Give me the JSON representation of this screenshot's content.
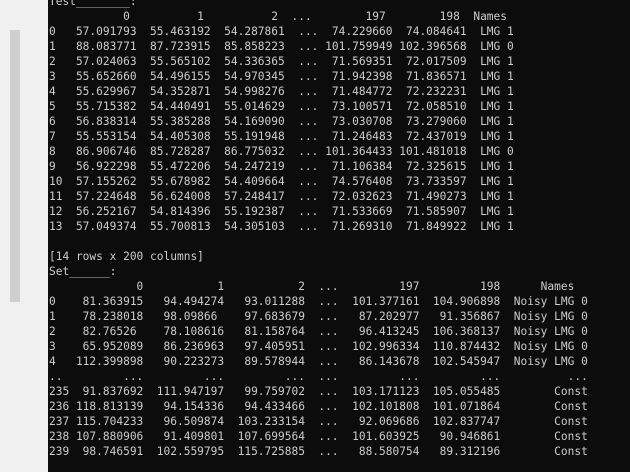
{
  "console": {
    "lines": [
      "Test________:",
      "           0          1          2  ...        197        198  Names",
      "0   57.091793  55.463192  54.287861  ...  74.229660  74.084641  LMG 1",
      "1   88.083771  87.723915  85.858223  ... 101.759949 102.396568  LMG 0",
      "2   57.024063  55.565102  54.336365  ...  71.569351  72.017509  LMG 1",
      "3   55.652660  54.496155  54.970345  ...  71.942398  71.836571  LMG 1",
      "4   55.629967  54.352871  54.998276  ...  71.484772  72.232231  LMG 1",
      "5   55.715382  54.440491  55.014629  ...  73.100571  72.058510  LMG 1",
      "6   56.838314  55.385288  54.169090  ...  73.030708  73.279060  LMG 1",
      "7   55.553154  54.405308  55.191948  ...  71.246483  72.437019  LMG 1",
      "8   86.906746  85.728287  86.775032  ... 101.364433 101.481018  LMG 0",
      "9   56.922298  55.472206  54.247219  ...  71.106384  72.325615  LMG 1",
      "10  57.155262  55.678982  54.409664  ...  74.576408  73.733597  LMG 1",
      "11  57.224648  56.624008  57.248417  ...  72.032623  71.490273  LMG 1",
      "12  56.252167  54.814396  55.192387  ...  71.533669  71.585907  LMG 1",
      "13  57.049374  55.700813  54.305103  ...  71.269310  71.849922  LMG 1",
      "",
      "[14 rows x 200 columns]",
      "Set______:",
      "             0           1           2  ...         197         198      Names",
      "0    81.363915   94.494274   93.011288  ...  101.377161  104.906898  Noisy LMG 0",
      "1    78.238018   98.09866    97.683679  ...   87.202977   91.356867  Noisy LMG 0",
      "2    82.76526    78.108616   81.158764  ...   96.413245  106.368137  Noisy LMG 0",
      "3    65.952089   86.236963   97.405951  ...  102.996334  110.874432  Noisy LMG 0",
      "4   112.399898   90.223273   89.578944  ...   86.143678  102.545947  Noisy LMG 0",
      "..         ...         ...         ...  ...         ...         ...          ...",
      "235  91.837692  111.947197   99.759702  ...  103.171123  105.055485        Const",
      "236 118.813139   94.154336   94.433466  ...  102.101808  101.071864        Const",
      "237 115.704233   96.509874  103.233154  ...   92.069686  102.837747        Const",
      "238 107.880906   91.409801  107.699564  ...  101.603925   90.946861        Const",
      "239  98.746591  102.559795  115.725885  ...   88.580754   89.312196        Const"
    ]
  }
}
